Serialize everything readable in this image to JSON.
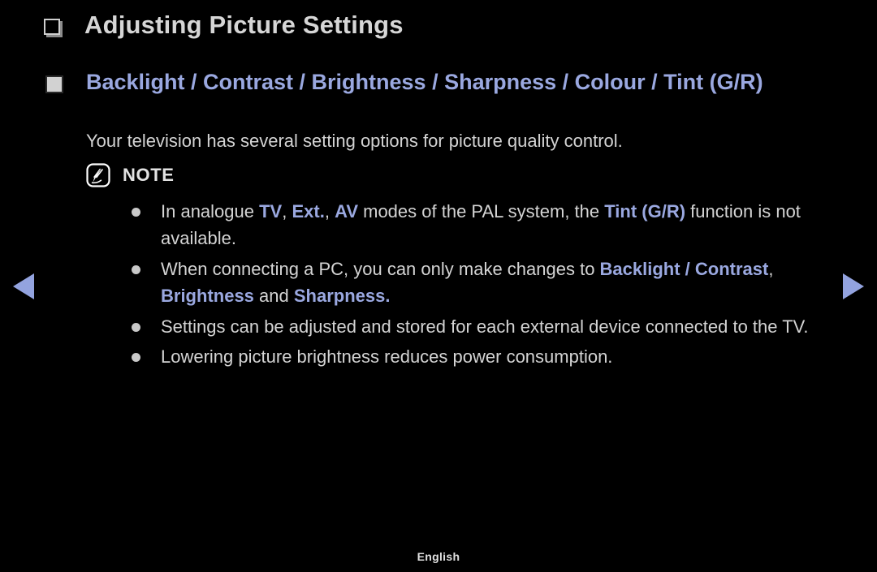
{
  "page": {
    "background_color": "#000000",
    "accent_color": "#9aa8e0",
    "body_text_color": "#d4d4d4"
  },
  "title": {
    "text": "Adjusting Picture Settings",
    "bullet_icon": "hollow-square-icon"
  },
  "section": {
    "bullet_icon": "filled-square-icon",
    "heading": "Backlight / Contrast / Brightness / Sharpness / Colour / Tint (G/R)",
    "description": "Your television has several setting options for picture quality control."
  },
  "note": {
    "icon": "note-pen-icon",
    "label": "NOTE",
    "items": [
      {
        "parts": [
          {
            "text": "In analogue ",
            "style": "normal"
          },
          {
            "text": "TV",
            "style": "accent"
          },
          {
            "text": ", ",
            "style": "normal"
          },
          {
            "text": "Ext.",
            "style": "accent"
          },
          {
            "text": ", ",
            "style": "normal"
          },
          {
            "text": "AV",
            "style": "accent"
          },
          {
            "text": " modes of the PAL system, the ",
            "style": "normal"
          },
          {
            "text": "Tint (G/R)",
            "style": "accent"
          },
          {
            "text": " function is not available.",
            "style": "normal"
          }
        ]
      },
      {
        "parts": [
          {
            "text": "When connecting a PC, you can only make changes to ",
            "style": "normal"
          },
          {
            "text": "Backlight / Contrast",
            "style": "accent"
          },
          {
            "text": ", ",
            "style": "normal"
          },
          {
            "text": "Brightness",
            "style": "accent"
          },
          {
            "text": " and ",
            "style": "normal"
          },
          {
            "text": "Sharpness.",
            "style": "accent"
          }
        ]
      },
      {
        "parts": [
          {
            "text": "Settings can be adjusted and stored for each external device connected to the TV.",
            "style": "normal"
          }
        ]
      },
      {
        "parts": [
          {
            "text": "Lowering picture brightness reduces power consumption.",
            "style": "normal"
          }
        ]
      }
    ]
  },
  "navigation": {
    "previous_icon": "triangle-left-icon",
    "next_icon": "triangle-right-icon"
  },
  "footer": {
    "language": "English"
  }
}
